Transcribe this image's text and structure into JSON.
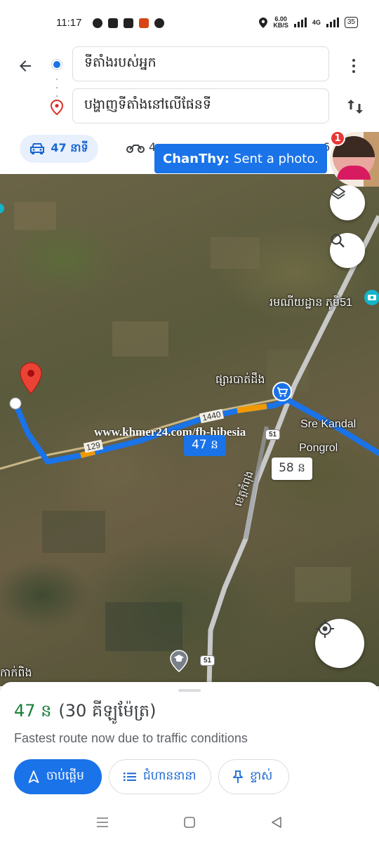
{
  "status_bar": {
    "time": "11:17",
    "speed_value": "6.00",
    "speed_unit": "KB/S",
    "network": "4G",
    "battery": "35"
  },
  "header": {
    "origin_text": "ទីតាំងរបស់អ្នក",
    "destination_text": "បង្ហាញទីតាំងនៅលើផែនទី"
  },
  "modes": {
    "drive_time": "47 នាទី",
    "moto_time_fragment": "4",
    "clipped_fragment": "6"
  },
  "chat_head": {
    "sender": "ChanThy:",
    "message": "Sent a photo.",
    "badge_count": "1"
  },
  "map": {
    "labels": {
      "market": "ផ្សារបាត់ដឹង",
      "sre_kandal": "Sre Kandal",
      "pongrol": "Pongrol",
      "camp": "រមណីយដ្ឋាន ភូមិ51",
      "province_road": "ខេត្តកំពុង",
      "edge_label": "កាក់ពិង"
    },
    "roads": {
      "r129": "129",
      "r1440": "1440",
      "r51_shield_top": "51",
      "r51_shield_bottom": "51"
    },
    "route_badge": "47 ន",
    "alt_badge": "58 ន",
    "watermark": "www.khmer24.com/fb-hibesia"
  },
  "sheet": {
    "duration": "47 ន",
    "distance": "(30 គីឡូម៉ែត្រ)",
    "note": "Fastest route now due to traffic conditions",
    "start_label": "ចាប់ផ្ដើម",
    "steps_label": "ជំហាននានា",
    "pin_label": "ខ្ទាស់"
  },
  "colors": {
    "accent": "#1a73e8",
    "eta_green": "#188038",
    "route_blue": "#1a73e8",
    "traffic_orange": "#f29900"
  }
}
